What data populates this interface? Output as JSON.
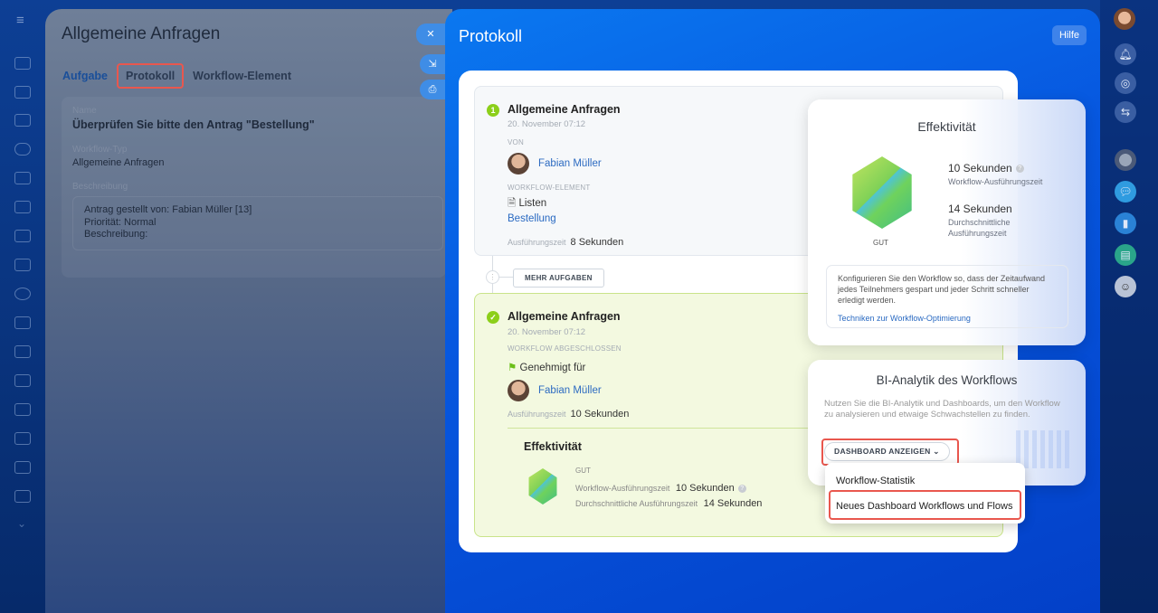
{
  "left_sidebar": {
    "icons": [
      "menu-icon",
      "presentation-icon",
      "inbox-icon",
      "mail-icon",
      "team-icon",
      "task-icon",
      "filter-icon",
      "calendar-icon",
      "storage-icon",
      "target-icon",
      "cart-icon",
      "document-edit-icon",
      "sign-icon",
      "chart-icon",
      "card-icon",
      "robot-icon",
      "box-icon",
      "chevron-down-icon"
    ]
  },
  "task_panel": {
    "title": "Allgemeine Anfragen",
    "tabs": [
      {
        "label": "Aufgabe"
      },
      {
        "label": "Protokoll"
      },
      {
        "label": "Workflow-Element"
      }
    ],
    "name_label": "Name",
    "name_value": "Überprüfen Sie bitte den Antrag \"Bestellung\"",
    "type_label": "Workflow-Typ",
    "type_value": "Allgemeine Anfragen",
    "desc_label": "Beschreibung",
    "desc_lines": [
      "Antrag gestellt von: Fabian Müller [13]",
      "Priorität: Normal",
      "Beschreibung:"
    ]
  },
  "protocol": {
    "title": "Protokoll",
    "help": "Hilfe",
    "step1": {
      "number": "1",
      "title": "Allgemeine Anfragen",
      "date": "20. November 07:12",
      "from_label": "VON",
      "user": "Fabian Müller",
      "element_label": "WORKFLOW-ELEMENT",
      "element_type": "Listen",
      "element_link": "Bestellung",
      "time_label": "Ausführungszeit",
      "time_value": "8 Sekunden"
    },
    "more_tasks": "MEHR AUFGABEN",
    "step2": {
      "title": "Allgemeine Anfragen",
      "date": "20. November 07:12",
      "status_label": "WORKFLOW ABGESCHLOSSEN",
      "approved": "Genehmigt für",
      "user": "Fabian Müller",
      "time_label": "Ausführungszeit",
      "time_value": "10 Sekunden",
      "eff_title": "Effektivität",
      "rating": "GUT",
      "exec_label": "Workflow-Ausführungszeit",
      "exec_value": "10 Sekunden",
      "avg_label": "Durchschnittliche Ausführungszeit",
      "avg_value": "14 Sekunden"
    }
  },
  "efficiency_card": {
    "title": "Effektivität",
    "rating": "GUT",
    "exec_value": "10 Sekunden",
    "exec_label": "Workflow-Ausführungszeit",
    "avg_value": "14 Sekunden",
    "avg_label_1": "Durchschnittliche",
    "avg_label_2": "Ausführungszeit",
    "tip": "Konfigurieren Sie den Workflow so, dass der Zeitaufwand jedes Teilnehmers gespart und jeder Schritt schneller erledigt werden.",
    "tip_link": "Techniken zur Workflow-Optimierung"
  },
  "bi_card": {
    "title": "BI-Analytik des Workflows",
    "text": "Nutzen Sie die BI-Analytik und Dashboards, um den Workflow zu analysieren und etwaige Schwachstellen zu finden.",
    "button": "DASHBOARD ANZEIGEN"
  },
  "dropdown": {
    "items": [
      "Workflow-Statistik",
      "Neues Dashboard Workflows und Flows"
    ]
  },
  "colors": {
    "accent": "#0a6ee8",
    "success": "#8ccf1a",
    "highlight": "#e9574e",
    "link": "#2d6bc1"
  }
}
